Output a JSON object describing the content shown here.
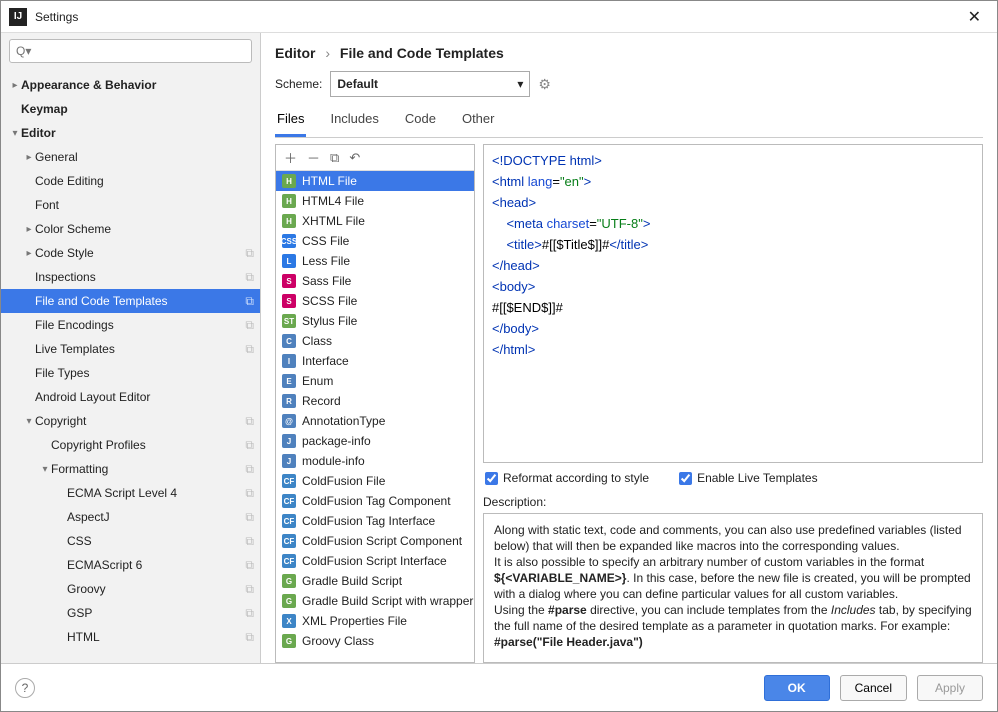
{
  "window": {
    "title": "Settings"
  },
  "search": {
    "placeholder": "Q▾"
  },
  "sidebar": [
    {
      "label": "Appearance & Behavior",
      "level": 0,
      "bold": true,
      "arrow": "▸",
      "copy": false
    },
    {
      "label": "Keymap",
      "level": 0,
      "bold": true,
      "arrow": "",
      "copy": false
    },
    {
      "label": "Editor",
      "level": 0,
      "bold": true,
      "arrow": "▾",
      "copy": false
    },
    {
      "label": "General",
      "level": 1,
      "arrow": "▸",
      "copy": false
    },
    {
      "label": "Code Editing",
      "level": 1,
      "arrow": "",
      "copy": false
    },
    {
      "label": "Font",
      "level": 1,
      "arrow": "",
      "copy": false
    },
    {
      "label": "Color Scheme",
      "level": 1,
      "arrow": "▸",
      "copy": false
    },
    {
      "label": "Code Style",
      "level": 1,
      "arrow": "▸",
      "copy": true
    },
    {
      "label": "Inspections",
      "level": 1,
      "arrow": "",
      "copy": true
    },
    {
      "label": "File and Code Templates",
      "level": 1,
      "arrow": "",
      "copy": true,
      "selected": true
    },
    {
      "label": "File Encodings",
      "level": 1,
      "arrow": "",
      "copy": true
    },
    {
      "label": "Live Templates",
      "level": 1,
      "arrow": "",
      "copy": true
    },
    {
      "label": "File Types",
      "level": 1,
      "arrow": "",
      "copy": false
    },
    {
      "label": "Android Layout Editor",
      "level": 1,
      "arrow": "",
      "copy": false
    },
    {
      "label": "Copyright",
      "level": 1,
      "arrow": "▾",
      "copy": true
    },
    {
      "label": "Copyright Profiles",
      "level": 2,
      "arrow": "",
      "copy": true
    },
    {
      "label": "Formatting",
      "level": 2,
      "arrow": "▾",
      "copy": true
    },
    {
      "label": "ECMA Script Level 4",
      "level": 3,
      "arrow": "",
      "copy": true
    },
    {
      "label": "AspectJ",
      "level": 3,
      "arrow": "",
      "copy": true
    },
    {
      "label": "CSS",
      "level": 3,
      "arrow": "",
      "copy": true
    },
    {
      "label": "ECMAScript 6",
      "level": 3,
      "arrow": "",
      "copy": true
    },
    {
      "label": "Groovy",
      "level": 3,
      "arrow": "",
      "copy": true
    },
    {
      "label": "GSP",
      "level": 3,
      "arrow": "",
      "copy": true
    },
    {
      "label": "HTML",
      "level": 3,
      "arrow": "",
      "copy": true
    }
  ],
  "breadcrumb": {
    "root": "Editor",
    "leaf": "File and Code Templates"
  },
  "scheme": {
    "label": "Scheme:",
    "value": "Default"
  },
  "tabs": [
    "Files",
    "Includes",
    "Code",
    "Other"
  ],
  "active_tab": 0,
  "templates": [
    {
      "label": "HTML File",
      "bg": "#6aa84f",
      "txt": "H",
      "selected": true
    },
    {
      "label": "HTML4 File",
      "bg": "#6aa84f",
      "txt": "H"
    },
    {
      "label": "XHTML File",
      "bg": "#6aa84f",
      "txt": "H"
    },
    {
      "label": "CSS File",
      "bg": "#2b78e4",
      "txt": "CSS"
    },
    {
      "label": "Less File",
      "bg": "#2b78e4",
      "txt": "L"
    },
    {
      "label": "Sass File",
      "bg": "#cc0066",
      "txt": "S"
    },
    {
      "label": "SCSS File",
      "bg": "#cc0066",
      "txt": "S"
    },
    {
      "label": "Stylus File",
      "bg": "#6aa84f",
      "txt": "ST"
    },
    {
      "label": "Class",
      "bg": "#4f81bd",
      "txt": "C"
    },
    {
      "label": "Interface",
      "bg": "#4f81bd",
      "txt": "I"
    },
    {
      "label": "Enum",
      "bg": "#4f81bd",
      "txt": "E"
    },
    {
      "label": "Record",
      "bg": "#4f81bd",
      "txt": "R"
    },
    {
      "label": "AnnotationType",
      "bg": "#4f81bd",
      "txt": "@"
    },
    {
      "label": "package-info",
      "bg": "#4f81bd",
      "txt": "J"
    },
    {
      "label": "module-info",
      "bg": "#4f81bd",
      "txt": "J"
    },
    {
      "label": "ColdFusion File",
      "bg": "#3d85c6",
      "txt": "CF"
    },
    {
      "label": "ColdFusion Tag Component",
      "bg": "#3d85c6",
      "txt": "CF"
    },
    {
      "label": "ColdFusion Tag Interface",
      "bg": "#3d85c6",
      "txt": "CF"
    },
    {
      "label": "ColdFusion Script Component",
      "bg": "#3d85c6",
      "txt": "CF"
    },
    {
      "label": "ColdFusion Script Interface",
      "bg": "#3d85c6",
      "txt": "CF"
    },
    {
      "label": "Gradle Build Script",
      "bg": "#6aa84f",
      "txt": "G"
    },
    {
      "label": "Gradle Build Script with wrapper",
      "bg": "#6aa84f",
      "txt": "G"
    },
    {
      "label": "XML Properties File",
      "bg": "#3d85c6",
      "txt": "X"
    },
    {
      "label": "Groovy Class",
      "bg": "#6aa84f",
      "txt": "G"
    }
  ],
  "checks": {
    "reformat": "Reformat according to style",
    "live": "Enable Live Templates"
  },
  "desc_label": "Description:",
  "buttons": {
    "ok": "OK",
    "cancel": "Cancel",
    "apply": "Apply"
  },
  "code": {
    "l1a": "<!DOCTYPE ",
    "l1b": "html",
    "l1c": ">",
    "l2a": "<html ",
    "l2b": "lang",
    "l2c": "=",
    "l2d": "\"en\"",
    "l2e": ">",
    "l3": "<head>",
    "l4a": "    <meta ",
    "l4b": "charset",
    "l4c": "=",
    "l4d": "\"UTF-8\"",
    "l4e": ">",
    "l5a": "    <title>",
    "l5b": "#[[$Title$]]#",
    "l5c": "</title>",
    "l6": "</head>",
    "l7": "<body>",
    "l8": "#[[$END$]]#",
    "l9": "</body>",
    "l10": "</html>"
  },
  "desc": {
    "p1": "Along with static text, code and comments, you can also use predefined variables (listed below) that will then be expanded like macros into the corresponding values.",
    "p2a": "It is also possible to specify an arbitrary number of custom variables in the format ",
    "p2b": "${<VARIABLE_NAME>}",
    "p2c": ". In this case, before the new file is created, you will be prompted with a dialog where you can define particular values for all custom variables.",
    "p3a": "Using the ",
    "p3b": "#parse",
    "p3c": " directive, you can include templates from the ",
    "p3d": "Includes",
    "p3e": " tab, by specifying the full name of the desired template as a parameter in quotation marks. For example:",
    "p4": "#parse(\"File Header.java\")"
  }
}
